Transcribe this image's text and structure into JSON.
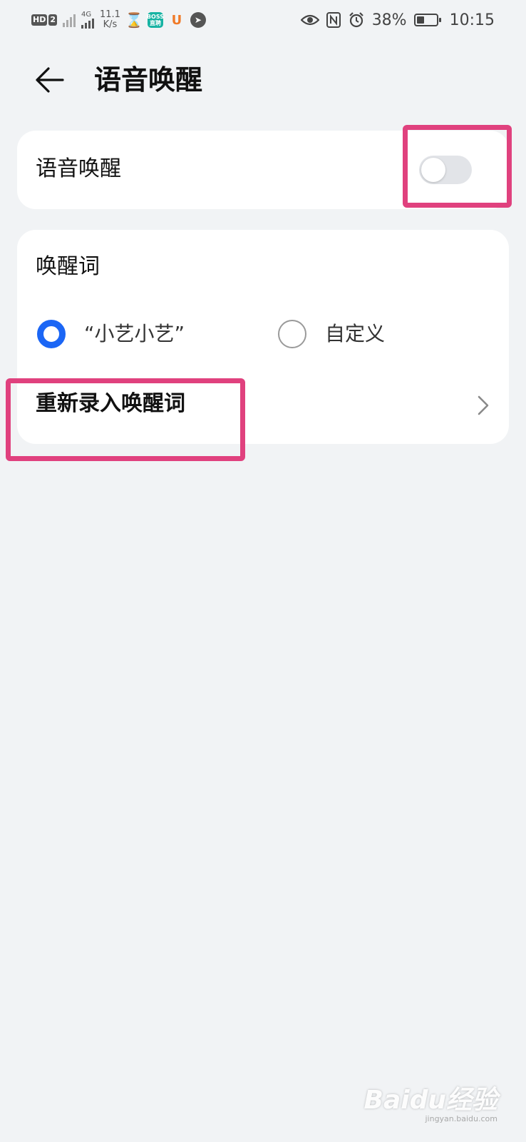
{
  "status_bar": {
    "hd_labels": [
      "HD",
      "2"
    ],
    "network": "4G",
    "speed_value": "11.1",
    "speed_unit": "K/s",
    "boss_label": "BOSS\n直聘",
    "battery_percent": "38%",
    "battery_level": 0.38,
    "time": "10:15"
  },
  "header": {
    "title": "语音唤醒"
  },
  "wake_card": {
    "label": "语音唤醒",
    "toggle_on": false
  },
  "wake_words": {
    "title": "唤醒词",
    "options": [
      {
        "label": "“小艺小艺”",
        "checked": true
      },
      {
        "label": "自定义",
        "checked": false
      }
    ],
    "rerecord_label": "重新录入唤醒词"
  },
  "colors": {
    "accent": "#1b66f5",
    "highlight": "#e0417e",
    "background": "#f1f3f5"
  },
  "watermark": {
    "logo": "Baidu经验",
    "url": "jingyan.baidu.com"
  }
}
